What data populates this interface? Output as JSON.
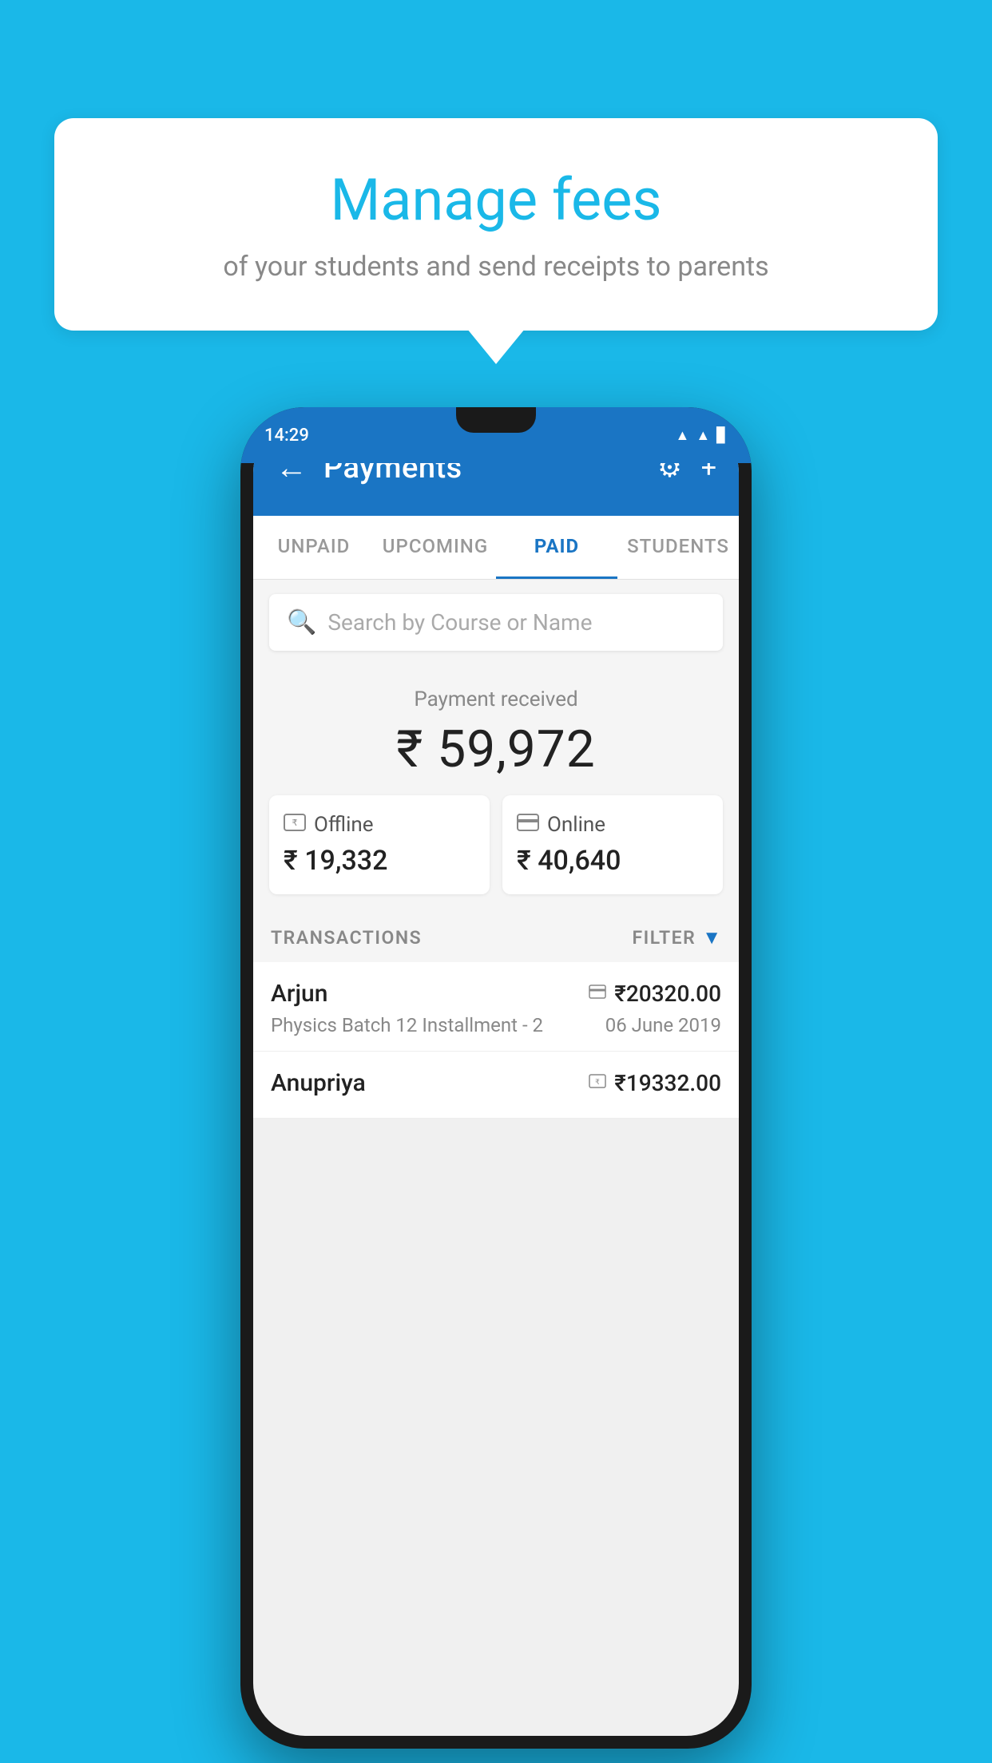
{
  "page": {
    "background_color": "#1ab8e8"
  },
  "speech_bubble": {
    "title": "Manage fees",
    "subtitle": "of your students and send receipts to parents"
  },
  "phone": {
    "status_bar": {
      "time": "14:29"
    },
    "header": {
      "back_label": "←",
      "title": "Payments",
      "settings_icon": "⚙",
      "add_icon": "+"
    },
    "tabs": [
      {
        "label": "UNPAID",
        "active": false
      },
      {
        "label": "UPCOMING",
        "active": false
      },
      {
        "label": "PAID",
        "active": true
      },
      {
        "label": "STUDENTS",
        "active": false
      }
    ],
    "search": {
      "placeholder": "Search by Course or Name"
    },
    "payment_summary": {
      "label": "Payment received",
      "total_amount": "₹ 59,972",
      "offline": {
        "icon": "💳",
        "label": "Offline",
        "amount": "₹ 19,332"
      },
      "online": {
        "icon": "💳",
        "label": "Online",
        "amount": "₹ 40,640"
      }
    },
    "transactions": {
      "header_label": "TRANSACTIONS",
      "filter_label": "FILTER",
      "items": [
        {
          "name": "Arjun",
          "mode_icon": "💳",
          "amount": "₹20320.00",
          "course": "Physics Batch 12 Installment - 2",
          "date": "06 June 2019"
        },
        {
          "name": "Anupriya",
          "mode_icon": "💵",
          "amount": "₹19332.00",
          "course": "",
          "date": ""
        }
      ]
    }
  }
}
